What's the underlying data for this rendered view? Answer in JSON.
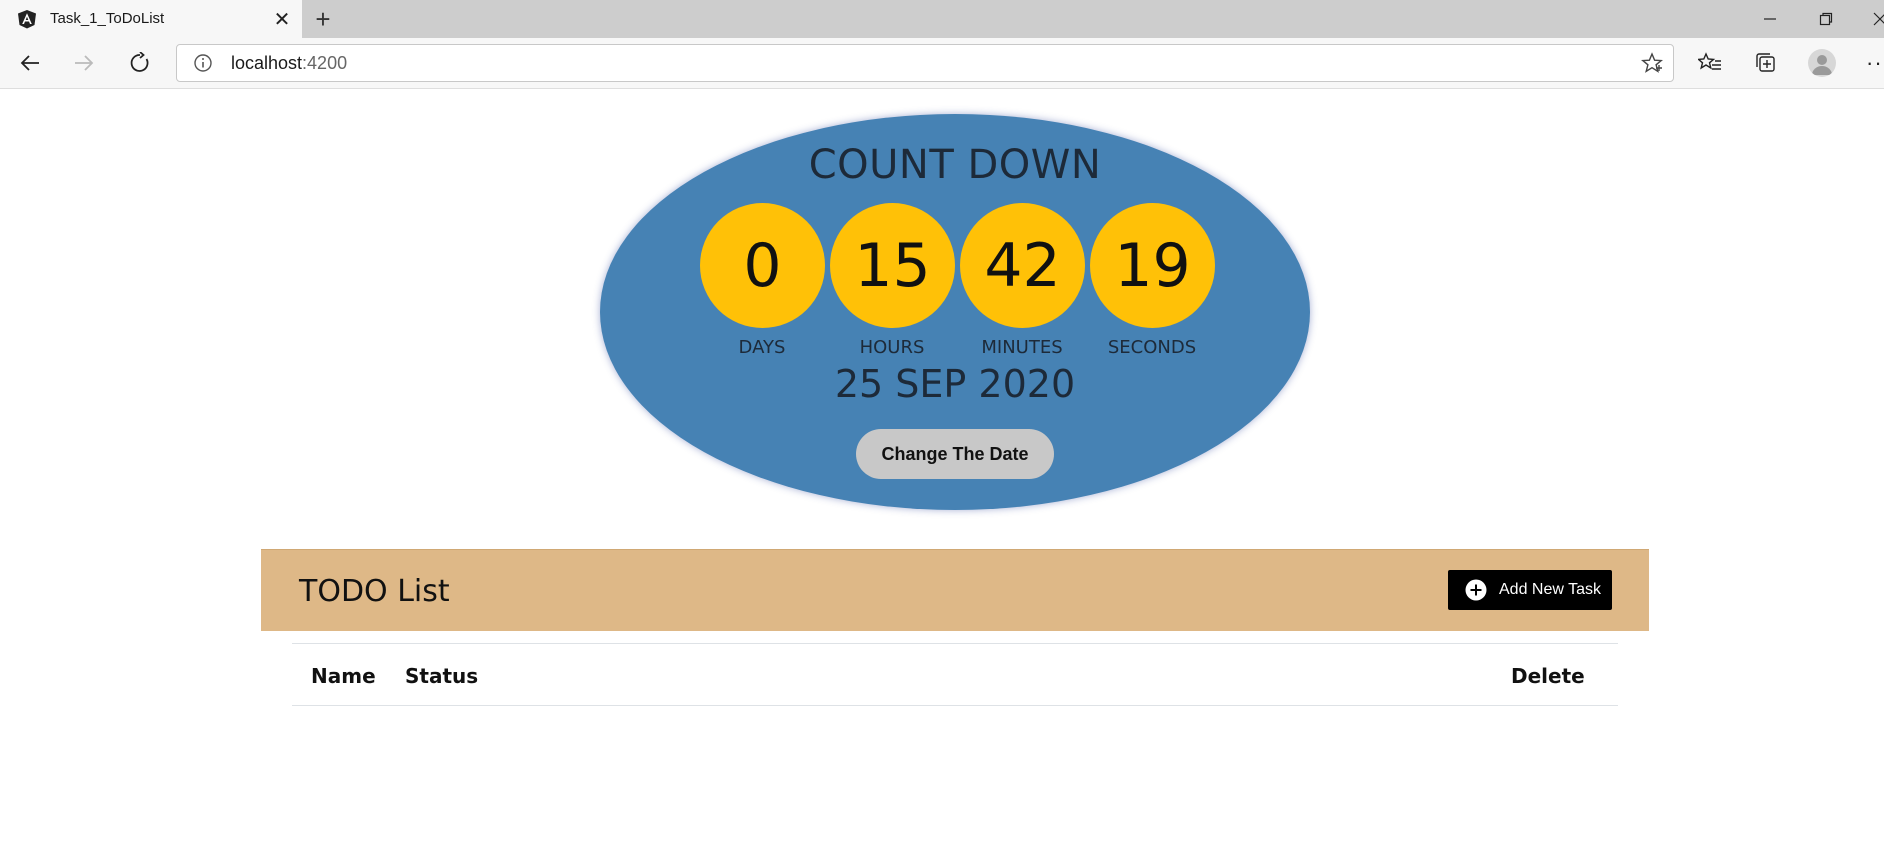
{
  "browser": {
    "tab_title": "Task_1_ToDoList",
    "tab_close": "✕",
    "new_tab": "+",
    "address_host": "localhost",
    "address_port": ":4200",
    "more": "···"
  },
  "countdown": {
    "title": "COUNT DOWN",
    "days": "0",
    "hours": "15",
    "minutes": "42",
    "seconds": "19",
    "days_label": "DAYS",
    "hours_label": "HOURS",
    "minutes_label": "MINUTES",
    "seconds_label": "SECONDS",
    "date": "25 SEP 2020",
    "change_button": "Change The Date"
  },
  "todo": {
    "title": "TODO List",
    "add_button": "Add New Task",
    "columns": [
      "Name",
      "Status",
      "Delete"
    ]
  },
  "colors": {
    "countdown_bg": "#4682b4",
    "circle_bg": "#ffc107",
    "todo_header_bg": "#deb887",
    "button_gray": "#c8c8c8"
  }
}
